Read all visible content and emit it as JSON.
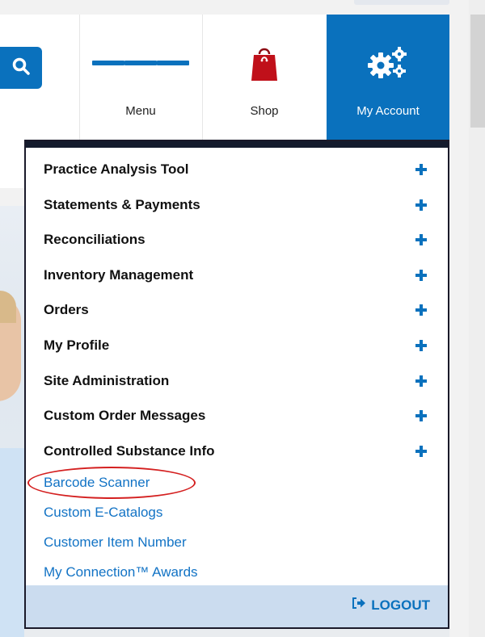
{
  "header": {
    "nav": [
      {
        "label": "Menu",
        "icon": "hamburger-icon"
      },
      {
        "label": "Shop",
        "icon": "shopping-bag-icon"
      },
      {
        "label": "My Account",
        "icon": "gears-icon"
      }
    ],
    "search_icon": "search-icon"
  },
  "dropdown": {
    "sections": [
      {
        "label": "Practice Analysis Tool"
      },
      {
        "label": "Statements & Payments"
      },
      {
        "label": "Reconciliations"
      },
      {
        "label": "Inventory Management"
      },
      {
        "label": "Orders"
      },
      {
        "label": "My Profile"
      },
      {
        "label": "Site Administration"
      },
      {
        "label": "Custom Order Messages"
      },
      {
        "label": "Controlled Substance Info"
      }
    ],
    "links": [
      {
        "label": "Barcode Scanner"
      },
      {
        "label": "Custom E-Catalogs"
      },
      {
        "label": "Customer Item Number"
      },
      {
        "label": "My Connection™ Awards"
      }
    ],
    "logout_label": "LOGOUT"
  },
  "colors": {
    "brand_blue": "#0a71bd",
    "link_blue": "#1273c5",
    "shop_red": "#c0101a",
    "logout_bar": "#cbdcef",
    "highlight_red": "#d42020"
  }
}
